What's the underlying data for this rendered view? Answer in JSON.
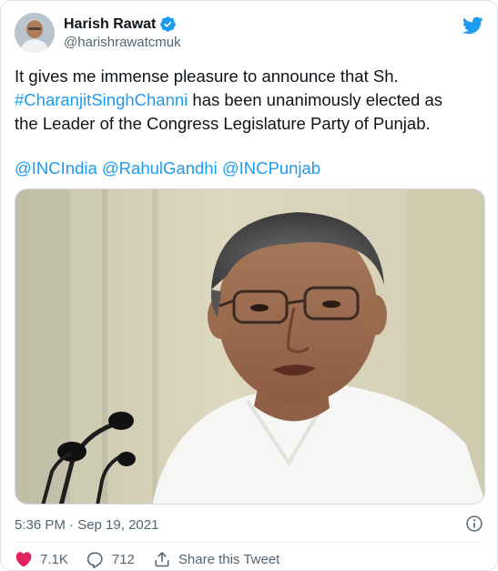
{
  "author": {
    "name": "Harish Rawat",
    "handle": "@harishrawatcmuk"
  },
  "tweet": {
    "line1": "It gives me immense pleasure to announce that Sh.",
    "hashtag": "#CharanjitSinghChanni",
    "line2_rest": " has been unanimously elected as",
    "line3": "the Leader of the Congress Legislature Party of Punjab.",
    "mentions": [
      "@INCIndia",
      "@RahulGandhi",
      "@INCPunjab"
    ]
  },
  "meta": {
    "timestamp": "5:36 PM · Sep 19, 2021"
  },
  "actions": {
    "likes": "7.1K",
    "replies": "712",
    "share_label": "Share this Tweet"
  },
  "colors": {
    "link": "#1d9bf0",
    "text": "#0f1419",
    "secondary": "#536471",
    "like_red": "#e0245e"
  }
}
